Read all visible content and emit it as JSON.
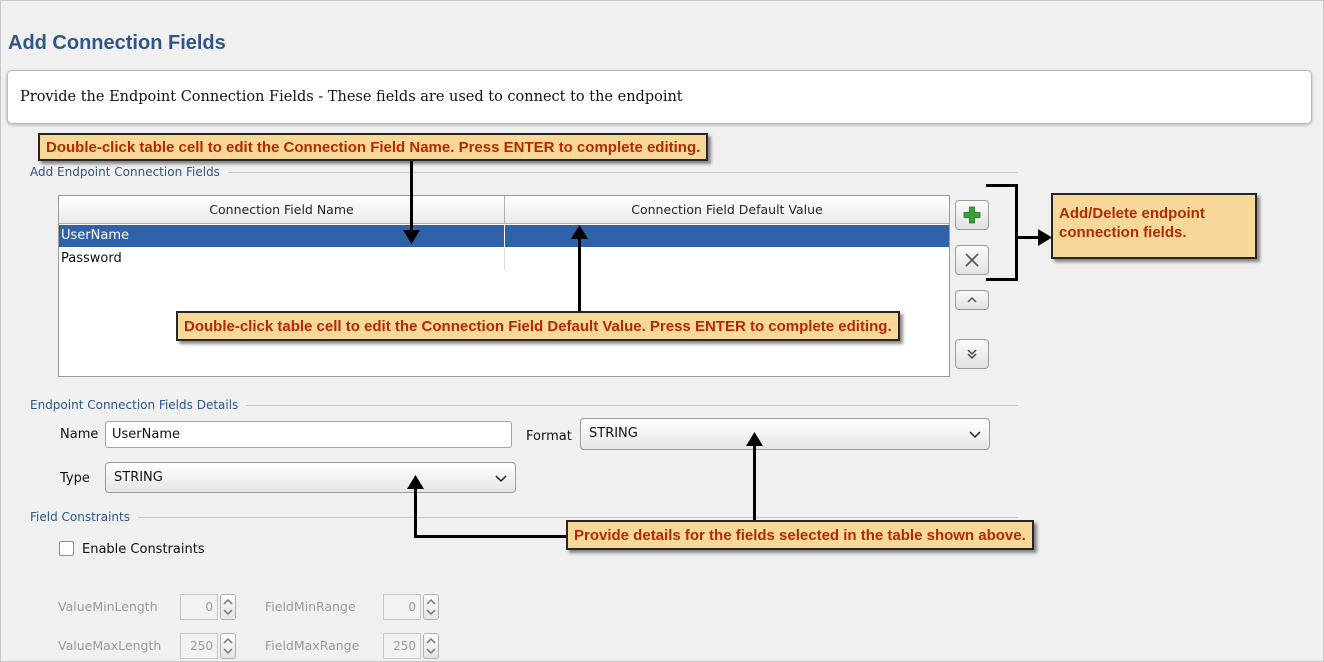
{
  "page": {
    "title": "Add Connection Fields",
    "description": "Provide the Endpoint Connection Fields - These fields are used to connect to the endpoint"
  },
  "add_section": {
    "label": "Add Endpoint Connection Fields",
    "table": {
      "columns": [
        "Connection Field Name",
        "Connection Field Default Value"
      ],
      "rows": [
        {
          "name": "UserName",
          "default_value": "",
          "selected": true
        },
        {
          "name": "Password",
          "default_value": "",
          "selected": false
        }
      ]
    },
    "buttons": {
      "add_icon": "plus-icon",
      "delete_icon": "close-icon",
      "move_up_icon": "chevron-up-icon",
      "move_down_icon": "double-chevron-down-icon"
    }
  },
  "details_section": {
    "label": "Endpoint Connection Fields Details",
    "name_label": "Name",
    "name_value": "UserName",
    "format_label": "Format",
    "format_value": "STRING",
    "type_label": "Type",
    "type_value": "STRING"
  },
  "constraints_section": {
    "label": "Field Constraints",
    "enable_label": "Enable Constraints",
    "enabled": false,
    "value_min_length_label": "ValueMinLength",
    "value_min_length": "0",
    "value_max_length_label": "ValueMaxLength",
    "value_max_length": "250",
    "field_min_range_label": "FieldMinRange",
    "field_min_range": "0",
    "field_max_range_label": "FieldMaxRange",
    "field_max_range": "250"
  },
  "callouts": {
    "name_edit": "Double-click table cell to edit the Connection Field Name. Press ENTER to complete editing.",
    "value_edit": "Double-click table cell to edit the Connection Field Default Value. Press ENTER to complete editing.",
    "add_delete": "Add/Delete endpoint connection fields.",
    "details": "Provide details for the fields selected in the table shown above."
  },
  "colors": {
    "title": "#2f5684",
    "selection": "#2f62a8",
    "callout_bg": "#f8d89a",
    "callout_text": "#b32a00"
  }
}
